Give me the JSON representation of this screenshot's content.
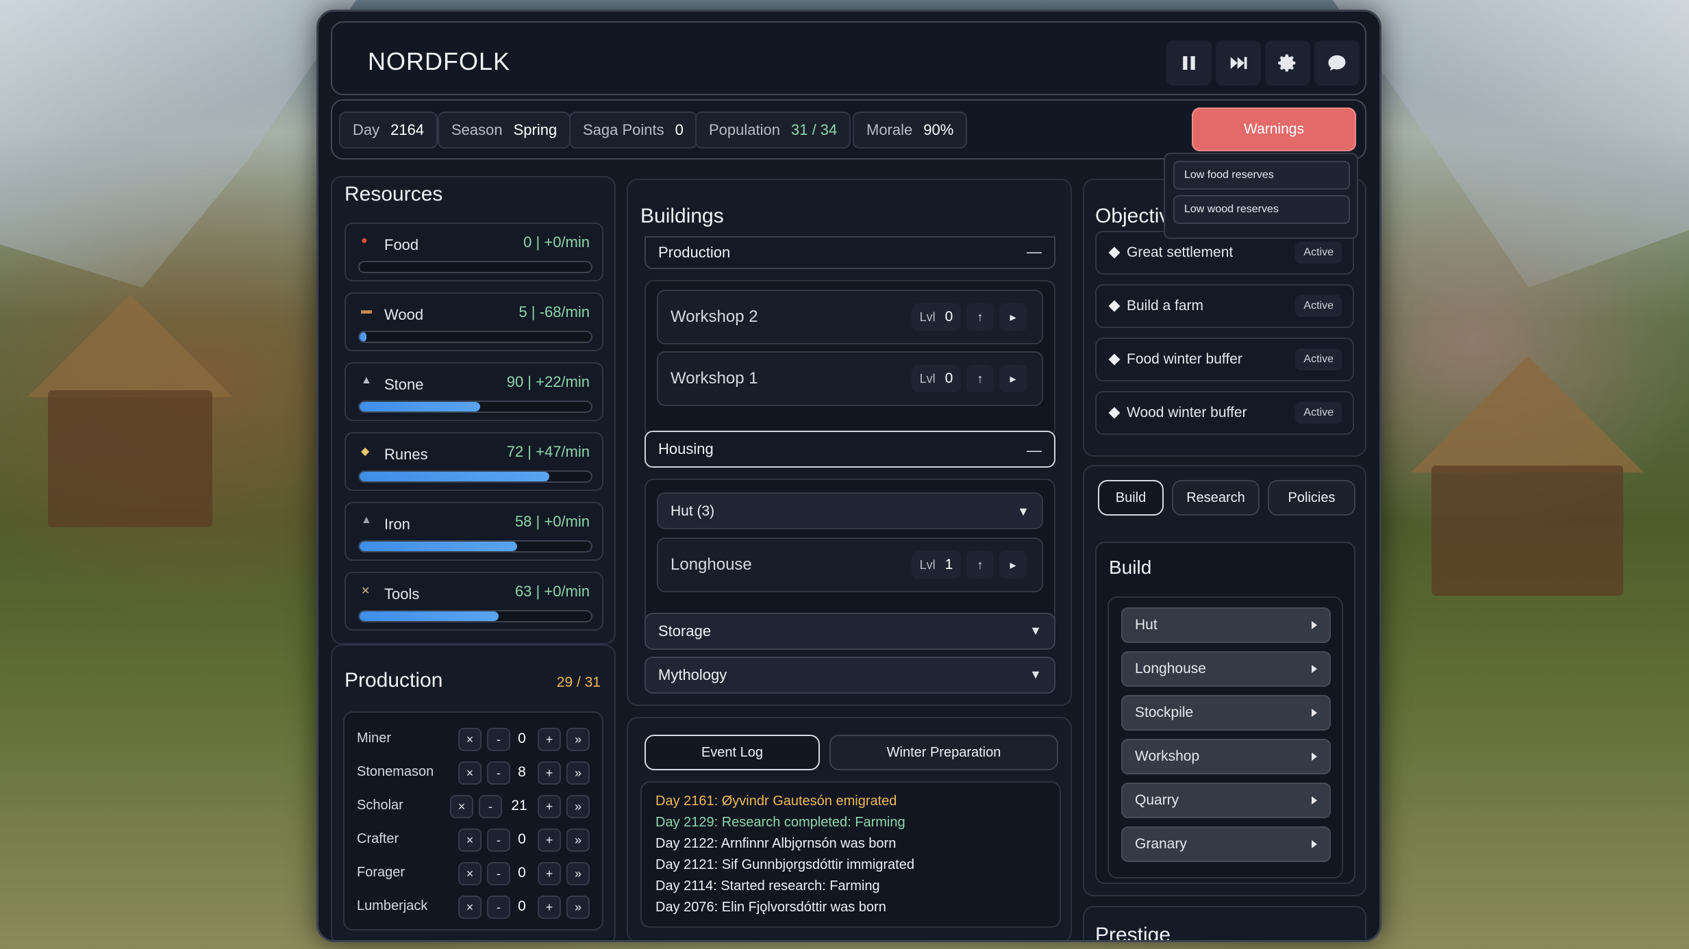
{
  "header": {
    "title": "NORDFOLK"
  },
  "toolbar": {
    "pause": "pause-icon",
    "skip": "fast-forward-icon",
    "settings": "gear-icon",
    "chat": "chat-icon"
  },
  "status": {
    "day_label": "Day",
    "day_value": "2164",
    "season_label": "Season",
    "season_value": "Spring",
    "saga_label": "Saga Points",
    "saga_value": "0",
    "pop_label": "Population",
    "pop_value": "31 / 34",
    "morale_label": "Morale",
    "morale_value": "90%"
  },
  "warnings": {
    "label": "Warnings",
    "items": [
      "Low food reserves",
      "Low wood reserves"
    ]
  },
  "resources": {
    "title": "Resources",
    "items": [
      {
        "name": "Food",
        "rate": "0 | +0/min",
        "fill": 0.0,
        "icon": "apple-icon"
      },
      {
        "name": "Wood",
        "rate": "5 | -68/min",
        "fill": 0.03,
        "icon": "log-icon"
      },
      {
        "name": "Stone",
        "rate": "90 | +22/min",
        "fill": 0.52,
        "icon": "stone-icon"
      },
      {
        "name": "Runes",
        "rate": "72 | +47/min",
        "fill": 0.82,
        "icon": "rune-icon"
      },
      {
        "name": "Iron",
        "rate": "58 | +0/min",
        "fill": 0.68,
        "icon": "ore-icon"
      },
      {
        "name": "Tools",
        "rate": "63 | +0/min",
        "fill": 0.6,
        "icon": "tools-icon"
      }
    ]
  },
  "production": {
    "title": "Production",
    "count": "29 / 31",
    "rows": [
      {
        "name": "Miner",
        "value": "0"
      },
      {
        "name": "Stonemason",
        "value": "8"
      },
      {
        "name": "Scholar",
        "value": "21"
      },
      {
        "name": "Crafter",
        "value": "0"
      },
      {
        "name": "Forager",
        "value": "0"
      },
      {
        "name": "Lumberjack",
        "value": "0"
      }
    ],
    "btn_remove": "×",
    "btn_minus": "-",
    "btn_plus": "+",
    "btn_max": "»"
  },
  "buildings": {
    "title": "Buildings",
    "production_cat": "Production",
    "workshop2": "Workshop 2",
    "workshop1": "Workshop 1",
    "housing_cat": "Housing",
    "hut_group": "Hut (3)",
    "longhouse": "Longhouse",
    "storage_cat": "Storage",
    "mythology_cat": "Mythology",
    "lvl_label": "Lvl",
    "workshop2_lvl": "0",
    "workshop1_lvl": "0",
    "longhouse_lvl": "1",
    "collapse": "—"
  },
  "log": {
    "tab_event": "Event Log",
    "tab_winter": "Winter Preparation",
    "lines": [
      {
        "text": "Day 2161: Øyvindr Gautesón emigrated",
        "color": "#f0b85a"
      },
      {
        "text": "Day 2129: Research completed: Farming",
        "color": "#8fd6ac"
      },
      {
        "text": "Day 2122: Arnfinnr Albjǫrnsón was born",
        "color": "#eef0f4"
      },
      {
        "text": "Day 2121: Sif Gunnbjǫrgsdóttir immigrated",
        "color": "#eef0f4"
      },
      {
        "text": "Day 2114: Started research: Farming",
        "color": "#eef0f4"
      },
      {
        "text": "Day 2076: Elin Fjǫlvorsdóttir was born",
        "color": "#eef0f4"
      }
    ]
  },
  "objectives": {
    "title": "Objectives",
    "items": [
      {
        "name": "Great settlement",
        "status": "Active"
      },
      {
        "name": "Build a farm",
        "status": "Active"
      },
      {
        "name": "Food winter buffer",
        "status": "Active"
      },
      {
        "name": "Wood winter buffer",
        "status": "Active"
      }
    ]
  },
  "tabs": {
    "build": "Build",
    "research": "Research",
    "policies": "Policies"
  },
  "build": {
    "title": "Build",
    "items": [
      "Hut",
      "Longhouse",
      "Stockpile",
      "Workshop",
      "Quarry",
      "Granary"
    ]
  },
  "prestige": {
    "title": "Prestige"
  }
}
